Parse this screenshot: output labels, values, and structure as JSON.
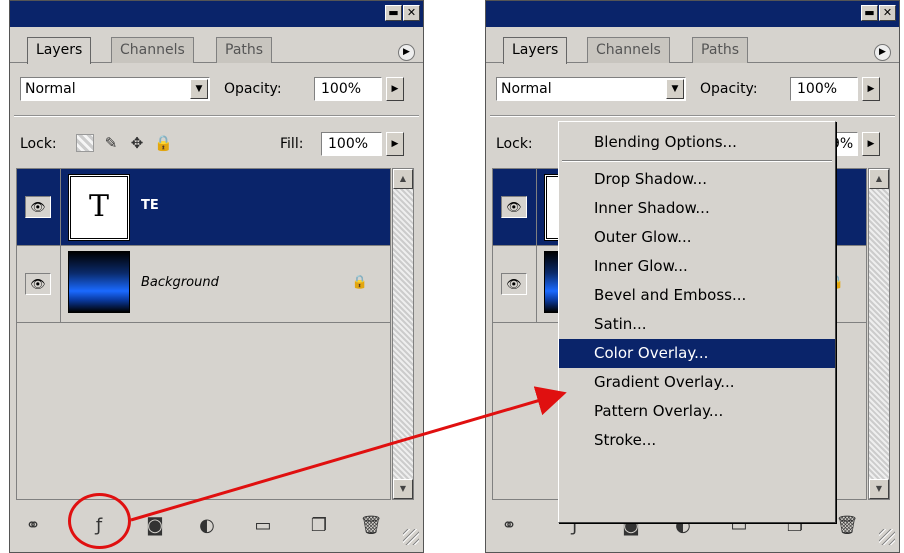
{
  "panels": {
    "window_buttons": {
      "minimize": "▬",
      "close": "✕"
    },
    "tabs": [
      "Layers",
      "Channels",
      "Paths"
    ],
    "blend_mode": "Normal",
    "opacity_label": "Opacity:",
    "opacity_value": "100%",
    "lock_label": "Lock:",
    "fill_label": "Fill:",
    "fill_value": "100%",
    "layers": [
      {
        "name": "TE",
        "selected": true,
        "thumbnail": "text-layer-thumbnail",
        "thumb_text": "T"
      },
      {
        "name": "Background",
        "selected": false,
        "locked": true,
        "thumbnail": "gradient-thumbnail"
      }
    ],
    "icons": {
      "visibility": "eye-icon",
      "lock": "lock-icon",
      "link": "link-icon",
      "add_style": "add-layer-style-icon",
      "mask": "add-mask-icon",
      "adjustment": "adjustment-layer-icon",
      "group": "folder-icon",
      "new_layer": "new-layer-icon",
      "delete": "trash-icon"
    },
    "colors": {
      "selection": "#0a246a",
      "panel_bg": "#d6d3ce",
      "annotation": "#e01010"
    }
  },
  "right_panel": {
    "visible_opacity_value_fragment": "9%",
    "visible_lock_label_fragment": "Lock:"
  },
  "context_menu": {
    "items": [
      {
        "label": "Blending Options..."
      },
      {
        "separator": true
      },
      {
        "label": "Drop Shadow..."
      },
      {
        "label": "Inner Shadow..."
      },
      {
        "label": "Outer Glow..."
      },
      {
        "label": "Inner Glow..."
      },
      {
        "label": "Bevel and Emboss..."
      },
      {
        "label": "Satin..."
      },
      {
        "label": "Color Overlay...",
        "highlighted": true
      },
      {
        "label": "Gradient Overlay..."
      },
      {
        "label": "Pattern Overlay..."
      },
      {
        "label": "Stroke..."
      }
    ]
  }
}
